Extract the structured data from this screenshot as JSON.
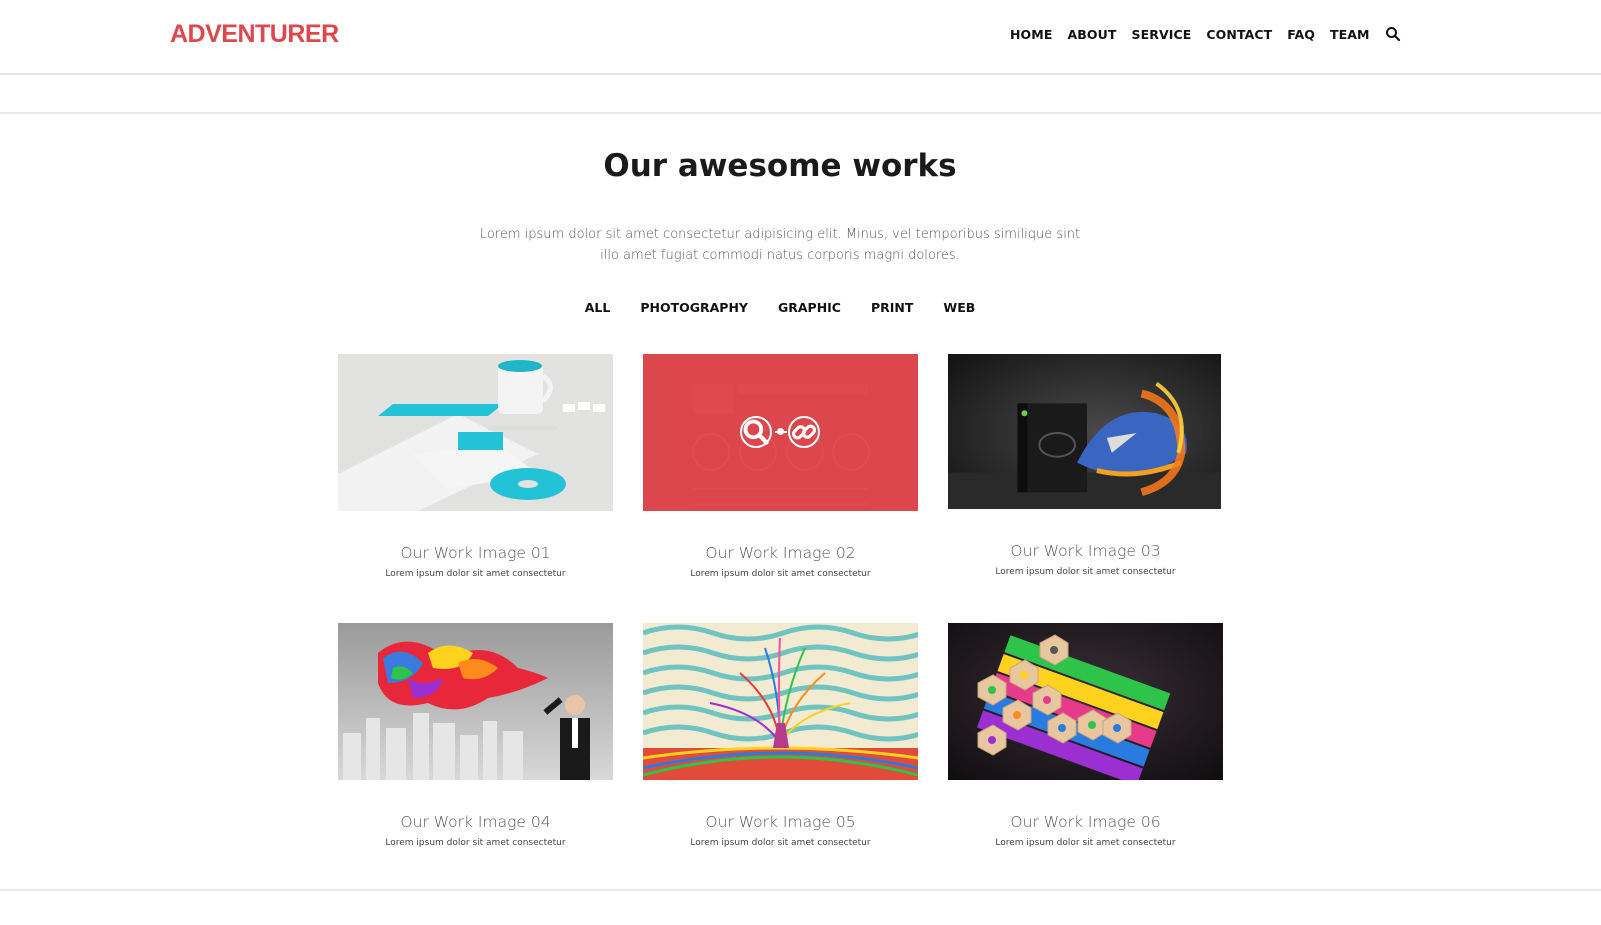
{
  "header": {
    "logo": "ADVENTURER",
    "nav": [
      "HOME",
      "ABOUT",
      "SERVICE",
      "CONTACT",
      "FAQ",
      "TEAM"
    ],
    "search_icon": "search-icon"
  },
  "section": {
    "title": "Our awesome works",
    "description": "Lorem ipsum dolor sit amet consectetur adipisicing elit. Minus, vel temporibus similique sint illo amet fugiat commodi natus corporis magni dolores.",
    "filters": [
      "ALL",
      "PHOTOGRAPHY",
      "GRAPHIC",
      "PRINT",
      "WEB"
    ]
  },
  "works": [
    {
      "title": "Our Work Image 01",
      "subtitle": "Lorem ipsum dolor sit amet consectetur",
      "image": "stationery-mockup"
    },
    {
      "title": "Our Work Image 02",
      "subtitle": "Lorem ipsum dolor sit amet consectetur",
      "image": "ui-dashboard",
      "hover_icons": [
        "search-icon",
        "link-icon"
      ]
    },
    {
      "title": "Our Work Image 03",
      "subtitle": "Lorem ipsum dolor sit amet consectetur",
      "image": "flaming-sneaker"
    },
    {
      "title": "Our Work Image 04",
      "subtitle": "Lorem ipsum dolor sit amet consectetur",
      "image": "businessman-paint-splash"
    },
    {
      "title": "Our Work Image 05",
      "subtitle": "Lorem ipsum dolor sit amet consectetur",
      "image": "psychedelic-tree"
    },
    {
      "title": "Our Work Image 06",
      "subtitle": "Lorem ipsum dolor sit amet consectetur",
      "image": "colored-pencils"
    }
  ],
  "colors": {
    "brand": "#e0474c",
    "text": "#111111",
    "muted": "#555555"
  }
}
